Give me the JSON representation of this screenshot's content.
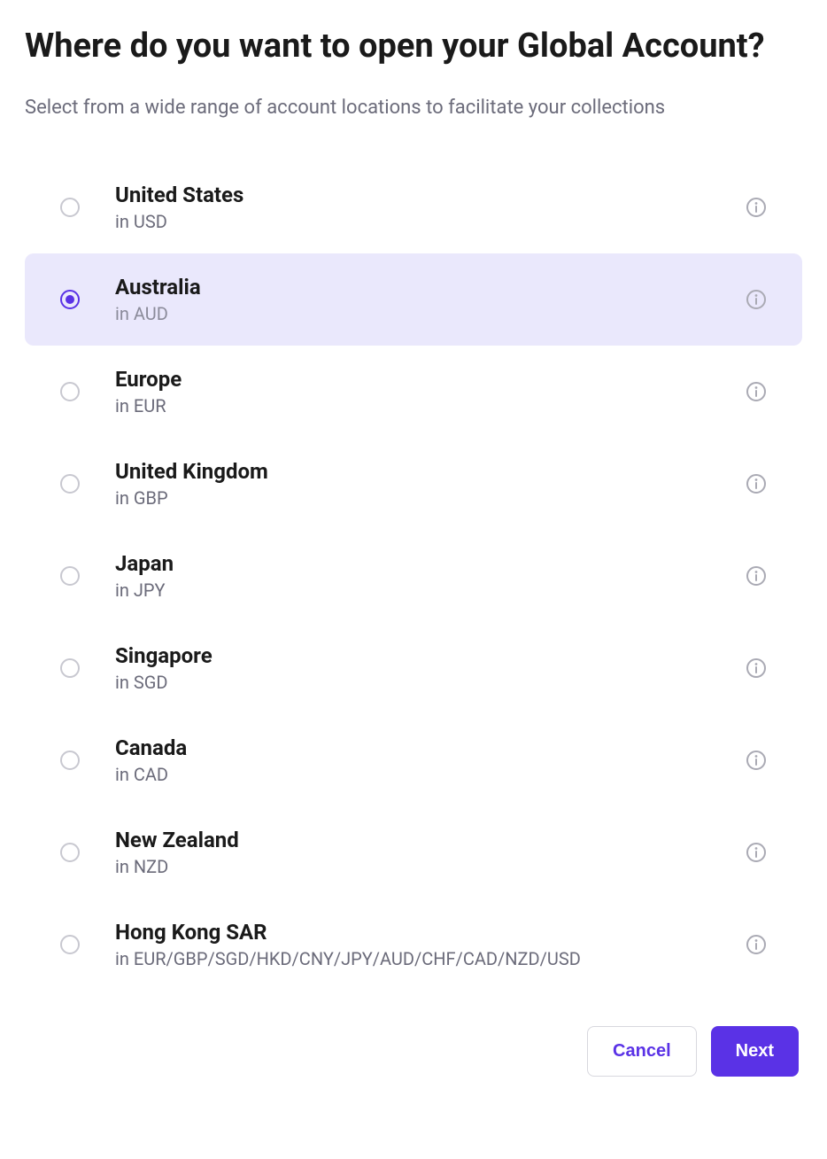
{
  "heading": "Where do you want to open your Global Account?",
  "subtitle": "Select from a wide range of account locations to facilitate your collections",
  "options": [
    {
      "name": "United States",
      "currency": "in USD",
      "selected": false
    },
    {
      "name": "Australia",
      "currency": "in AUD",
      "selected": true
    },
    {
      "name": "Europe",
      "currency": "in EUR",
      "selected": false
    },
    {
      "name": "United Kingdom",
      "currency": "in GBP",
      "selected": false
    },
    {
      "name": "Japan",
      "currency": "in JPY",
      "selected": false
    },
    {
      "name": "Singapore",
      "currency": "in SGD",
      "selected": false
    },
    {
      "name": "Canada",
      "currency": "in CAD",
      "selected": false
    },
    {
      "name": "New Zealand",
      "currency": "in NZD",
      "selected": false
    },
    {
      "name": "Hong Kong SAR",
      "currency": "in EUR/GBP/SGD/HKD/CNY/JPY/AUD/CHF/CAD/NZD/USD",
      "selected": false
    }
  ],
  "buttons": {
    "cancel": "Cancel",
    "next": "Next"
  }
}
